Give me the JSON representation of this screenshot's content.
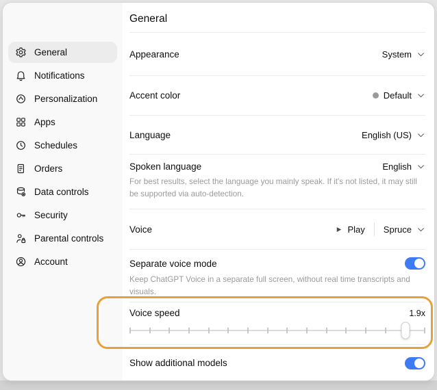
{
  "colors": {
    "accent_blue": "#3d7bf5",
    "highlight_orange": "#e9a03b",
    "sidebar_bg": "#f9f9f9",
    "selected_item_bg": "#ececec"
  },
  "sidebar": {
    "items": [
      {
        "label": "General",
        "icon": "gear-icon",
        "selected": true
      },
      {
        "label": "Notifications",
        "icon": "bell-icon",
        "selected": false
      },
      {
        "label": "Personalization",
        "icon": "personalization-icon",
        "selected": false
      },
      {
        "label": "Apps",
        "icon": "apps-grid-icon",
        "selected": false
      },
      {
        "label": "Schedules",
        "icon": "clock-icon",
        "selected": false
      },
      {
        "label": "Orders",
        "icon": "receipt-icon",
        "selected": false
      },
      {
        "label": "Data controls",
        "icon": "database-icon",
        "selected": false
      },
      {
        "label": "Security",
        "icon": "key-icon",
        "selected": false
      },
      {
        "label": "Parental controls",
        "icon": "person-lock-icon",
        "selected": false
      },
      {
        "label": "Account",
        "icon": "account-icon",
        "selected": false
      }
    ]
  },
  "panel": {
    "title": "General",
    "appearance": {
      "label": "Appearance",
      "value": "System"
    },
    "accent_color": {
      "label": "Accent color",
      "value": "Default"
    },
    "language": {
      "label": "Language",
      "value": "English (US)"
    },
    "spoken_language": {
      "label": "Spoken language",
      "value": "English",
      "description": "For best results, select the language you mainly speak. If it's not listed, it may still be supported via auto-detection."
    },
    "voice": {
      "label": "Voice",
      "play_label": "Play",
      "value": "Spruce"
    },
    "separate_voice_mode": {
      "label": "Separate voice mode",
      "description": "Keep ChatGPT Voice in a separate full screen, without real time transcripts and visuals.",
      "enabled": true
    },
    "voice_speed": {
      "label": "Voice speed",
      "value": "1.9x",
      "slider": {
        "tick_count": 16,
        "knob_index": 14
      }
    },
    "show_additional_models": {
      "label": "Show additional models",
      "enabled": true
    }
  }
}
